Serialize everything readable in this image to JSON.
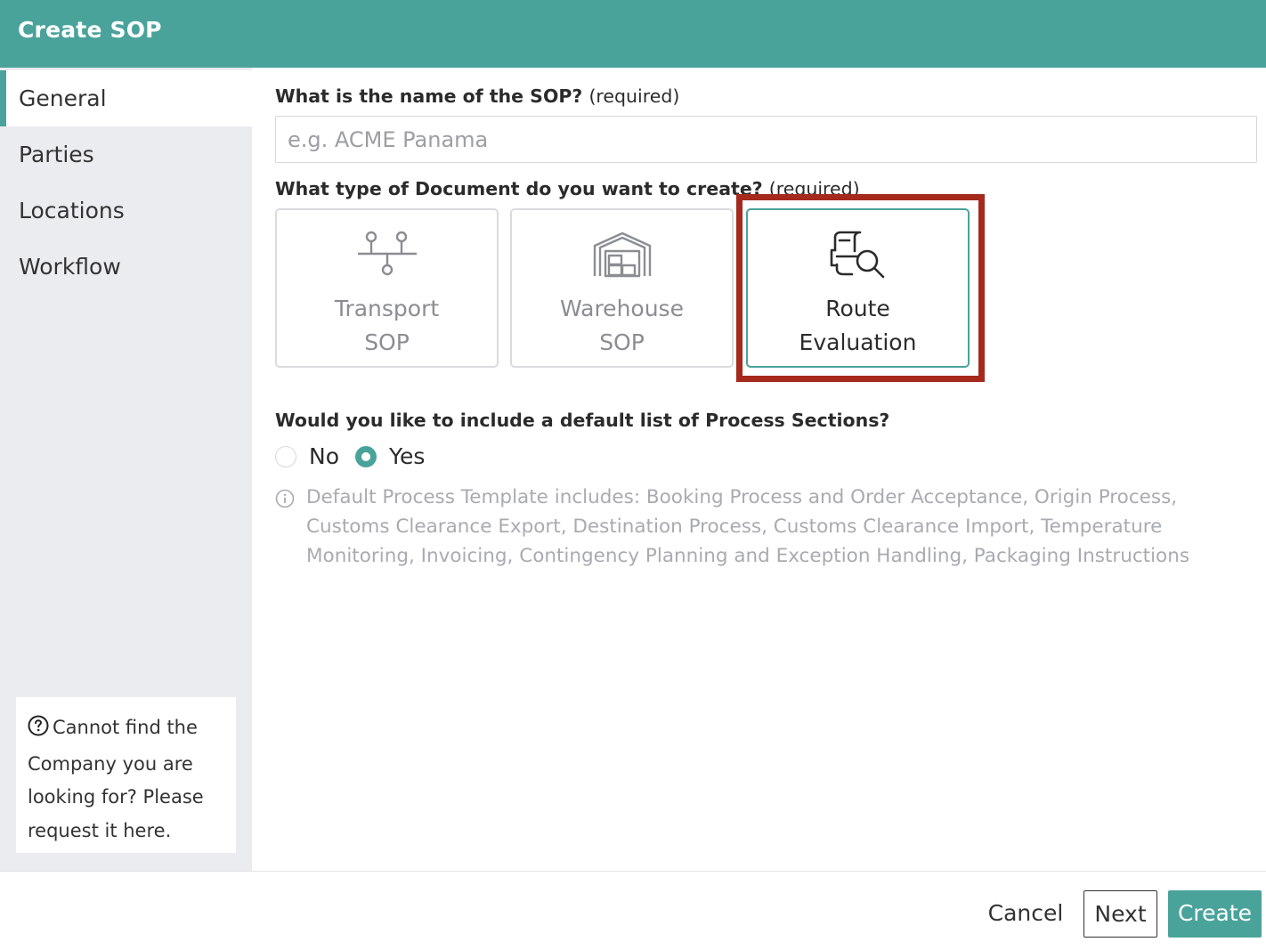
{
  "window": {
    "title": "Create SOP"
  },
  "sidebar": {
    "items": [
      {
        "label": "General",
        "active": true
      },
      {
        "label": "Parties",
        "active": false
      },
      {
        "label": "Locations",
        "active": false
      },
      {
        "label": "Workflow",
        "active": false
      }
    ],
    "help": {
      "text": "Cannot find the Company you are looking for? Please request it here."
    }
  },
  "form": {
    "name_question": "What is the name of the SOP?",
    "name_required": "(required)",
    "name_value": "",
    "name_placeholder": "e.g. ACME Panama",
    "type_question": "What type of Document do you want to create?",
    "type_required": "(required)",
    "types": [
      {
        "line1": "Transport",
        "line2": "SOP",
        "icon": "transport-icon",
        "selected": false
      },
      {
        "line1": "Warehouse",
        "line2": "SOP",
        "icon": "warehouse-icon",
        "selected": false
      },
      {
        "line1": "Route",
        "line2": "Evaluation",
        "icon": "route-evaluation-icon",
        "selected": true
      }
    ],
    "sections_question": "Would you like to include a default list of Process Sections?",
    "radio_no": "No",
    "radio_yes": "Yes",
    "radio_selected": "Yes",
    "info_text": "Default Process Template includes: Booking Process and Order Acceptance, Origin Process, Customs Clearance Export, Destination Process, Customs Clearance Import, Temperature Monitoring, Invoicing, Contingency Planning and Exception Handling, Packaging Instructions"
  },
  "footer": {
    "cancel_label": "Cancel",
    "next_label": "Next",
    "create_label": "Create"
  },
  "colors": {
    "accent": "#4aa39b",
    "highlight": "#a5291c",
    "sidebar_bg": "#ebecf0"
  }
}
